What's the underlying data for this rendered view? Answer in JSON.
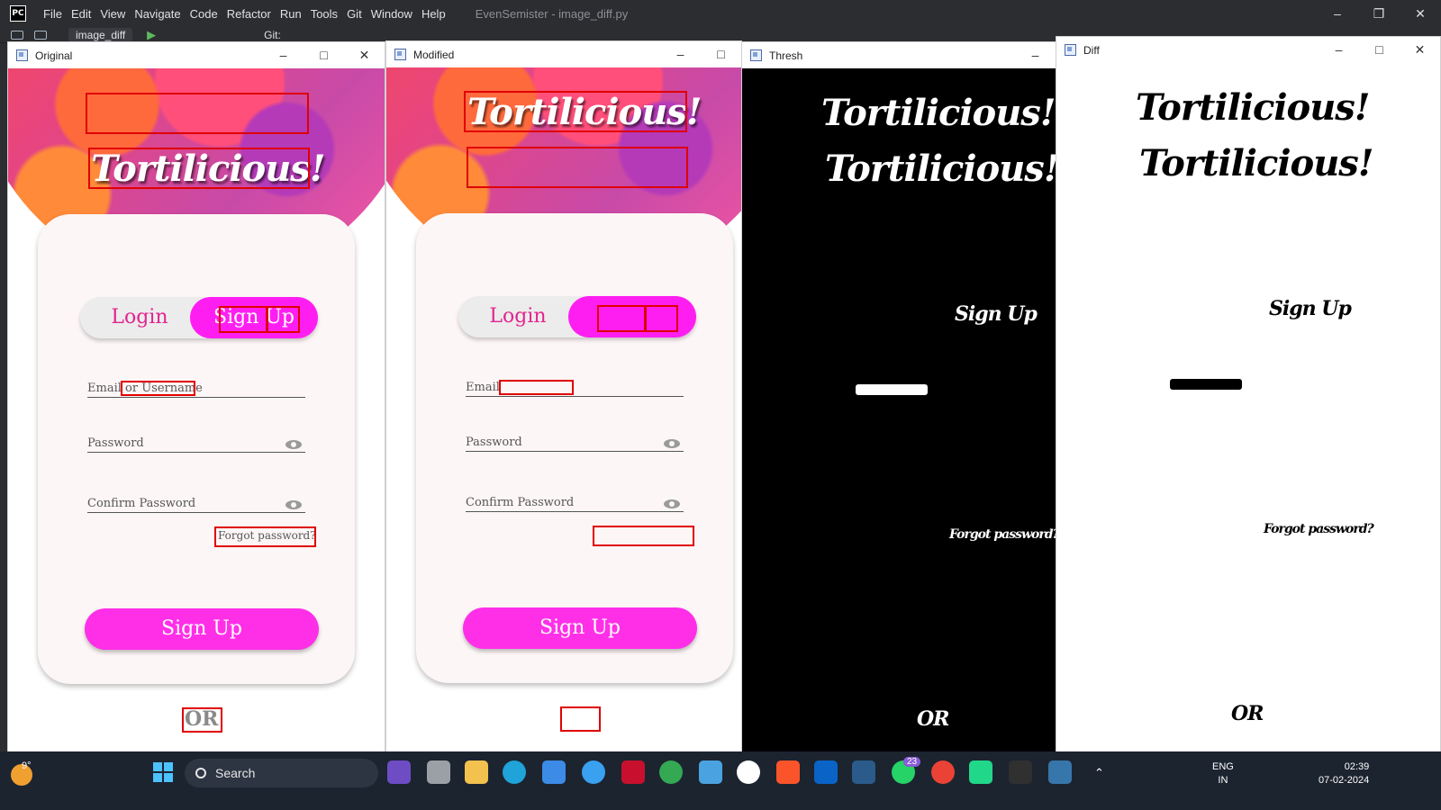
{
  "ide": {
    "logo": "PC",
    "menu": [
      "File",
      "Edit",
      "View",
      "Navigate",
      "Code",
      "Refactor",
      "Run",
      "Tools",
      "Git",
      "Window",
      "Help"
    ],
    "title": "EvenSemister - image_diff.py",
    "run_config": "image_diff",
    "git_label": "Git:"
  },
  "windows": {
    "original": {
      "title": "Original"
    },
    "modified": {
      "title": "Modified"
    },
    "thresh": {
      "title": "Thresh"
    },
    "diff": {
      "title": "Diff"
    }
  },
  "app_original": {
    "hero_title": "Tortilicious!",
    "login": "Login",
    "signup_toggle": "Sign Up",
    "email_label": "Email or Username",
    "password_label": "Password",
    "confirm_label": "Confirm Password",
    "forgot": "Forgot password?",
    "signup_button": "Sign Up",
    "or": "OR"
  },
  "app_modified": {
    "hero_title": "Tortilicious!",
    "login": "Login",
    "email_label": "Email",
    "password_label": "Password",
    "confirm_label": "Confirm Password",
    "signup_button": "Sign Up"
  },
  "thresh": {
    "title1": "Tortilicious!",
    "title2": "Tortilicious!",
    "signup": "Sign Up",
    "forgot": "Forgot password?",
    "or": "OR"
  },
  "diff": {
    "title1": "Tortilicious!",
    "title2": "Tortilicious!",
    "signup": "Sign Up",
    "forgot": "Forgot password?",
    "or": "OR"
  },
  "taskbar": {
    "temp": "9°",
    "search": "Search",
    "whatsapp_badge": "23",
    "lang1": "ENG",
    "lang2": "IN",
    "time": "02:39",
    "date": "07-02-2024"
  },
  "colors": {
    "accent_pink": "#ff1ef2",
    "login_pink": "#e2258f",
    "diff_box_red": "#e00000"
  }
}
